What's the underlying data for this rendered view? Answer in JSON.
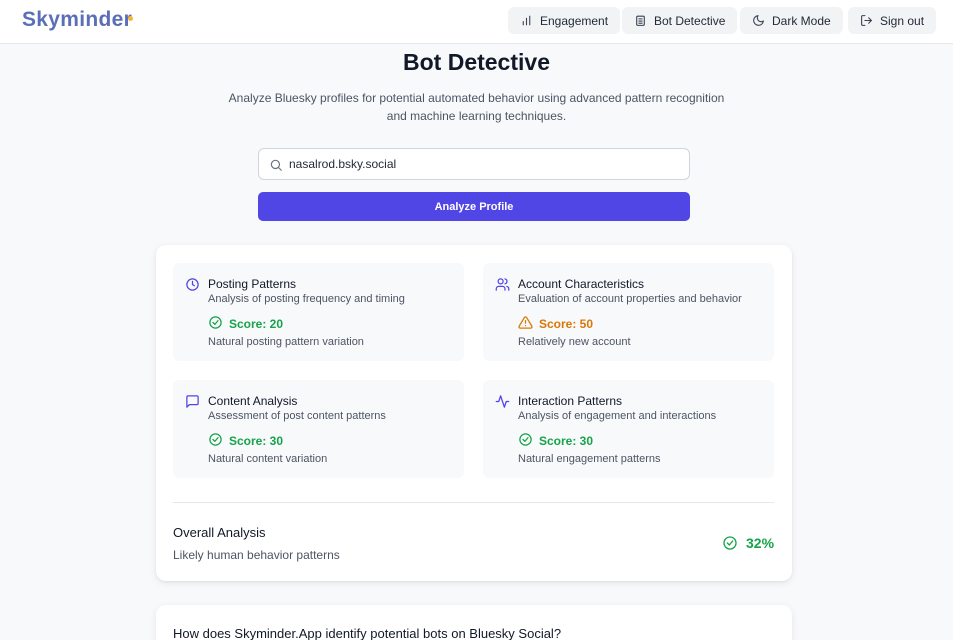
{
  "app": {
    "logo": "Skyminder"
  },
  "nav": {
    "engagement": "Engagement",
    "bot_detective": "Bot Detective",
    "dark_mode": "Dark Mode",
    "sign_out": "Sign out"
  },
  "hero": {
    "title": "Bot Detective",
    "subtitle": "Analyze Bluesky profiles for potential automated behavior using advanced pattern recognition and machine learning techniques."
  },
  "search": {
    "value": "nasalrod.bsky.social",
    "icon": "search-icon",
    "button": "Analyze Profile"
  },
  "metrics": [
    {
      "title": "Posting Patterns",
      "description": "Analysis of posting frequency and timing",
      "score": "Score: 20",
      "note": "Natural posting pattern variation",
      "icon": "clock-icon",
      "status": "pass"
    },
    {
      "title": "Account Characteristics",
      "description": "Evaluation of account properties and behavior",
      "score": "Score: 50",
      "note": "Relatively new account",
      "icon": "users-icon",
      "status": "warning"
    },
    {
      "title": "Content Analysis",
      "description": "Assessment of post content patterns",
      "score": "Score: 30",
      "note": "Natural content variation",
      "icon": "message-square-icon",
      "status": "pass"
    },
    {
      "title": "Interaction Patterns",
      "description": "Analysis of engagement and interactions",
      "score": "Score: 30",
      "note": "Natural engagement patterns",
      "icon": "activity-icon",
      "status": "pass"
    }
  ],
  "overall": {
    "title": "Overall Analysis",
    "description": "Likely human behavior patterns",
    "value": "32%"
  },
  "faq": {
    "question": "How does Skyminder.App identify potential bots on Bluesky Social?"
  },
  "colors": {
    "accent": "#4f46e5",
    "pass": "#16a34a",
    "warning": "#d97706",
    "icon": "#4f46e5"
  }
}
